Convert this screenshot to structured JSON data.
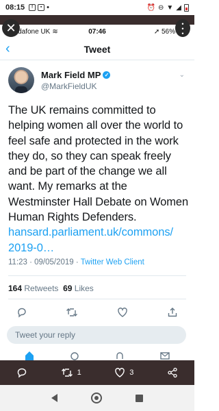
{
  "android_status": {
    "time": "08:15",
    "notif_icons": [
      "facebook-icon",
      "gallery-icon"
    ],
    "dot": "•"
  },
  "ios_status": {
    "carrier": "odafone UK",
    "time": "07:46",
    "battery": "56%"
  },
  "nav": {
    "title": "Tweet"
  },
  "author": {
    "display_name": "Mark Field MP",
    "handle": "@MarkFieldUK"
  },
  "tweet": {
    "text": "The UK remains committed to helping women all over the world to feel safe and protected in the work they do, so they can speak freely and be part of the change we all want. My remarks at the Westminster Hall Debate on Women Human Rights Defenders.",
    "link": "hansard.parliament.uk/commons/ 2019-0…",
    "time": "11:23 · 09/05/2019 · ",
    "client": "Twitter Web Client"
  },
  "stats": {
    "retweets": "164",
    "retweets_label": "Retweets",
    "likes": "69",
    "likes_label": "Likes"
  },
  "reply": {
    "placeholder": "Tweet your reply"
  },
  "overlay_bar": {
    "retweet_count": "1",
    "like_count": "3"
  },
  "colors": {
    "accent": "#1da1f2",
    "overlay": "#3a2d2d",
    "text": "#14171a",
    "muted": "#657786"
  }
}
